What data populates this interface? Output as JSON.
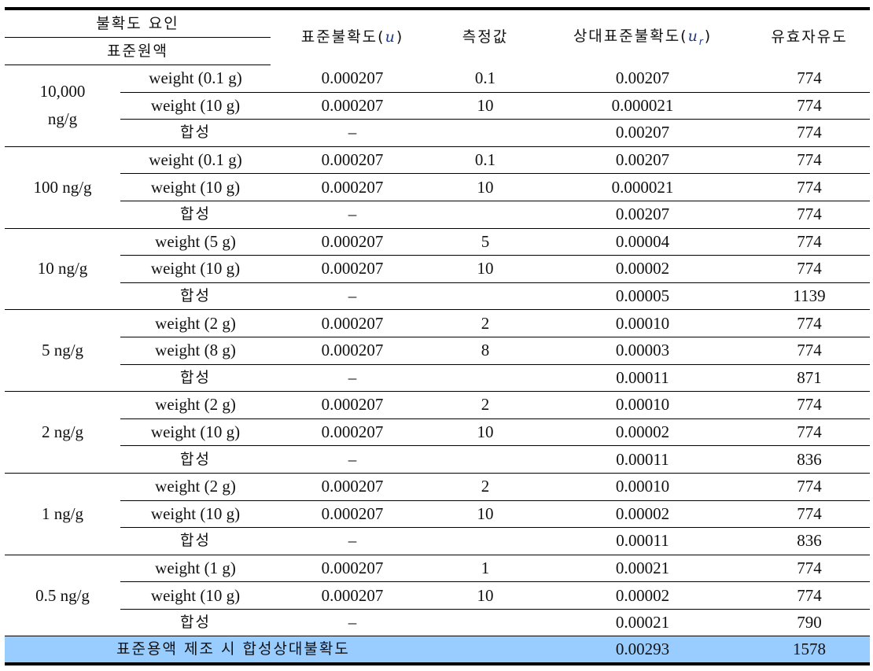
{
  "header": {
    "factor_label": "불확도 요인",
    "source_label": "표준원액",
    "std_uncertainty_label": "표준불확도(",
    "std_uncertainty_symbol": "u",
    "measured_label": "측정값",
    "rel_uncertainty_label": "상대표준불확도(",
    "rel_uncertainty_symbol": "u",
    "rel_uncertainty_subscript": "r",
    "close_paren": ")",
    "dof_label": "유효자유도"
  },
  "groups": [
    {
      "concentration_line1": "10,000",
      "concentration_line2": "ng/g",
      "rows": [
        {
          "item": "weight (0.1 g)",
          "u": "0.000207",
          "value": "0.1",
          "ur": "0.00207",
          "dof": "774"
        },
        {
          "item": "weight (10 g)",
          "u": "0.000207",
          "value": "10",
          "ur": "0.000021",
          "dof": "774"
        },
        {
          "item": "합성",
          "u": "–",
          "value": "",
          "ur": "0.00207",
          "dof": "774"
        }
      ]
    },
    {
      "concentration_line1": "100 ng/g",
      "concentration_line2": "",
      "rows": [
        {
          "item": "weight (0.1 g)",
          "u": "0.000207",
          "value": "0.1",
          "ur": "0.00207",
          "dof": "774"
        },
        {
          "item": "weight (10 g)",
          "u": "0.000207",
          "value": "10",
          "ur": "0.000021",
          "dof": "774"
        },
        {
          "item": "합성",
          "u": "–",
          "value": "",
          "ur": "0.00207",
          "dof": "774"
        }
      ]
    },
    {
      "concentration_line1": "10 ng/g",
      "concentration_line2": "",
      "rows": [
        {
          "item": "weight (5 g)",
          "u": "0.000207",
          "value": "5",
          "ur": "0.00004",
          "dof": "774"
        },
        {
          "item": "weight (10 g)",
          "u": "0.000207",
          "value": "10",
          "ur": "0.00002",
          "dof": "774"
        },
        {
          "item": "합성",
          "u": "–",
          "value": "",
          "ur": "0.00005",
          "dof": "1139"
        }
      ]
    },
    {
      "concentration_line1": "5 ng/g",
      "concentration_line2": "",
      "rows": [
        {
          "item": "weight (2 g)",
          "u": "0.000207",
          "value": "2",
          "ur": "0.00010",
          "dof": "774"
        },
        {
          "item": "weight (8 g)",
          "u": "0.000207",
          "value": "8",
          "ur": "0.00003",
          "dof": "774"
        },
        {
          "item": "합성",
          "u": "–",
          "value": "",
          "ur": "0.00011",
          "dof": "871"
        }
      ]
    },
    {
      "concentration_line1": "2 ng/g",
      "concentration_line2": "",
      "rows": [
        {
          "item": "weight (2 g)",
          "u": "0.000207",
          "value": "2",
          "ur": "0.00010",
          "dof": "774"
        },
        {
          "item": "weight (10 g)",
          "u": "0.000207",
          "value": "10",
          "ur": "0.00002",
          "dof": "774"
        },
        {
          "item": "합성",
          "u": "–",
          "value": "",
          "ur": "0.00011",
          "dof": "836"
        }
      ]
    },
    {
      "concentration_line1": "1 ng/g",
      "concentration_line2": "",
      "rows": [
        {
          "item": "weight (2 g)",
          "u": "0.000207",
          "value": "2",
          "ur": "0.00010",
          "dof": "774"
        },
        {
          "item": "weight (10 g)",
          "u": "0.000207",
          "value": "10",
          "ur": "0.00002",
          "dof": "774"
        },
        {
          "item": "합성",
          "u": "–",
          "value": "",
          "ur": "0.00011",
          "dof": "836"
        }
      ]
    },
    {
      "concentration_line1": "0.5 ng/g",
      "concentration_line2": "",
      "rows": [
        {
          "item": "weight (1 g)",
          "u": "0.000207",
          "value": "1",
          "ur": "0.00021",
          "dof": "774"
        },
        {
          "item": "weight (10 g)",
          "u": "0.000207",
          "value": "10",
          "ur": "0.00002",
          "dof": "774"
        },
        {
          "item": "합성",
          "u": "–",
          "value": "",
          "ur": "0.00021",
          "dof": "790"
        }
      ]
    }
  ],
  "total": {
    "label": "표준용액 제조 시 합성상대불확도",
    "ur": "0.00293",
    "dof": "1578"
  },
  "colors": {
    "total_row_bg": "#99ccff",
    "math_symbol": "#1f3a8a"
  }
}
